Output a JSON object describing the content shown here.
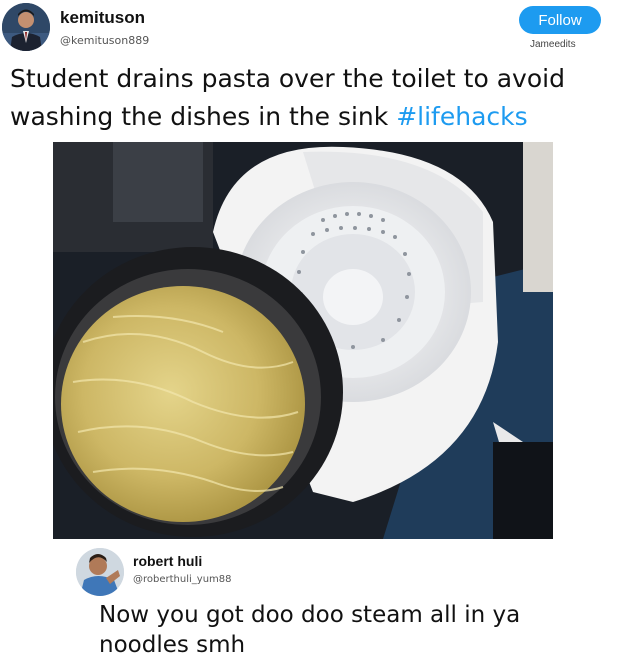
{
  "post": {
    "author_name": "kemituson",
    "author_handle": "@kemituson889",
    "follow_label": "Follow",
    "watermark": "Jameedits",
    "text": "Student drains pasta over the toilet to avoid washing the dishes in the sink ",
    "hashtag": "#lifehacks",
    "avatar_icon": "profile-photo-man-in-suit",
    "photo_icon": "photo-pasta-pot-over-toilet-with-colander"
  },
  "reply": {
    "author_name": "robert huli",
    "author_handle": "@roberthuli_yum88",
    "text": "Now you got doo doo steam all in ya noodles smh",
    "avatar_icon": "profile-photo-man-in-blue-shirt"
  },
  "colors": {
    "follow_button": "#1d9bf0",
    "hashtag": "#1d9bf0",
    "text": "#111111",
    "muted": "#555555"
  }
}
